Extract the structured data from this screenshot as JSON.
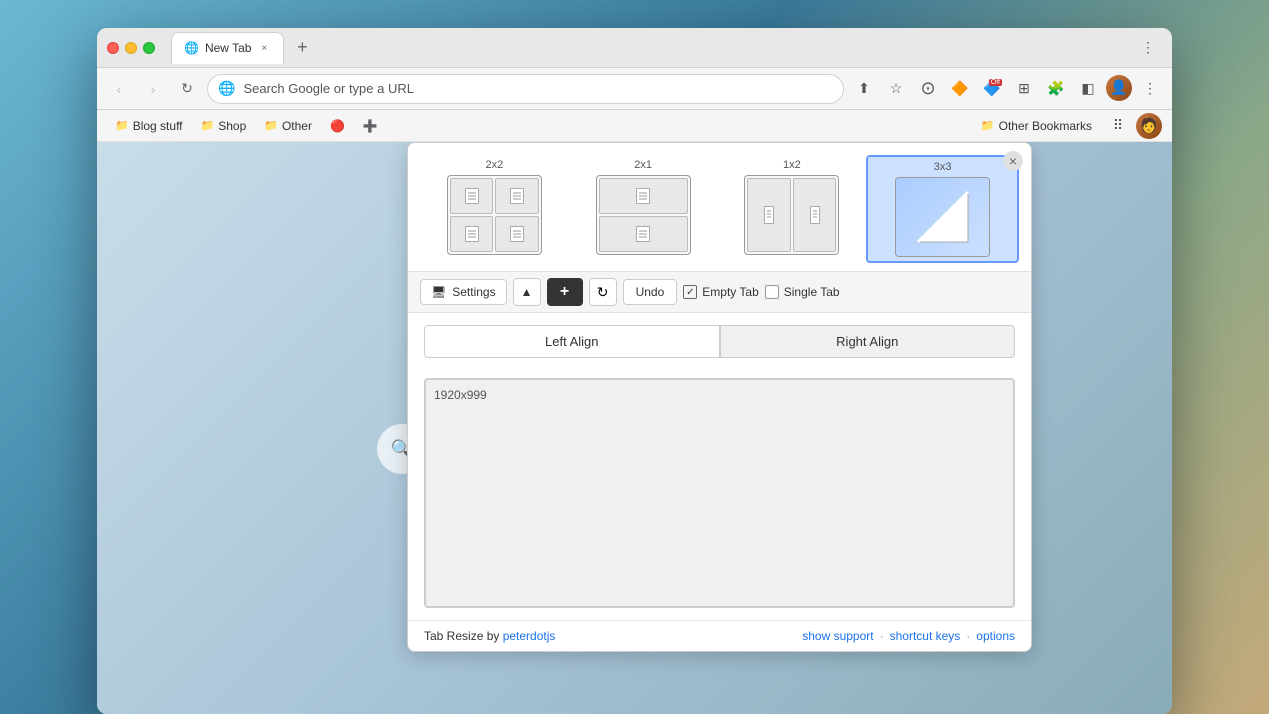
{
  "desktop": {
    "background": "mountain landscape"
  },
  "browser": {
    "tab": {
      "title": "New Tab",
      "favicon": "🌐",
      "close_label": "×"
    },
    "new_tab_label": "+",
    "nav": {
      "back_label": "‹",
      "forward_label": "›",
      "refresh_label": "↻",
      "address_placeholder": "Search Google or type a URL",
      "address_value": "Search Google or type a URL"
    },
    "bookmarks": [
      {
        "label": "Blog stuff",
        "icon": "📁"
      },
      {
        "label": "Shop",
        "icon": "📁"
      },
      {
        "label": "Other",
        "icon": "📁"
      },
      {
        "label": "Other Bookmarks",
        "icon": "📁"
      }
    ]
  },
  "popup": {
    "layouts": [
      {
        "id": "2x2",
        "label": "2x2",
        "selected": false
      },
      {
        "id": "2x1",
        "label": "2x1",
        "selected": false
      },
      {
        "id": "1x2",
        "label": "1x2",
        "selected": false
      },
      {
        "id": "3x3",
        "label": "3x3",
        "selected": true
      }
    ],
    "close_label": "×",
    "settings": {
      "settings_label": "Settings",
      "collapse_label": "▲",
      "add_label": "+",
      "undo_label": "Undo",
      "empty_tab_label": "Empty Tab",
      "empty_tab_checked": true,
      "single_tab_label": "Single Tab",
      "single_tab_checked": false
    },
    "align": {
      "left_label": "Left Align",
      "right_label": "Right Align",
      "active": "right"
    },
    "preview": {
      "dimensions": "1920x999"
    },
    "footer": {
      "brand_text": "Tab Resize by ",
      "brand_link": "peterdotjs",
      "show_support_label": "show support",
      "shortcut_keys_label": "shortcut keys",
      "options_label": "options",
      "separator": "·"
    }
  }
}
